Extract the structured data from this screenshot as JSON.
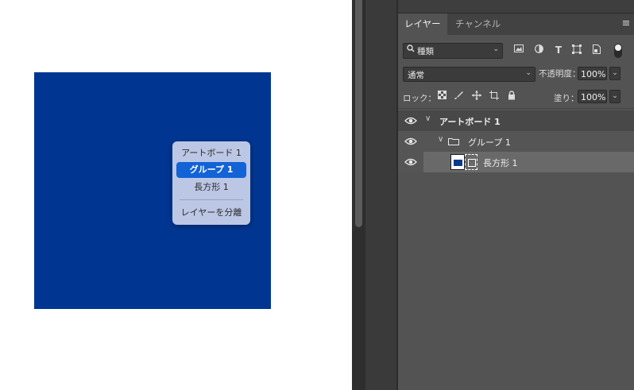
{
  "canvas": {
    "artboard_color": "#003692",
    "context_menu": {
      "items": [
        "アートボード 1",
        "グループ 1",
        "長方形 1"
      ],
      "selected_index": 1,
      "action": "レイヤーを分離"
    }
  },
  "layers_panel": {
    "tabs": [
      "レイヤー",
      "チャンネル"
    ],
    "active_tab": "レイヤー",
    "filter_label": "種類",
    "blend_mode": "通常",
    "opacity_label": "不透明度：",
    "opacity_value": "100%",
    "lock_label": "ロック：",
    "fill_label": "塗り：",
    "fill_value": "100%",
    "layers": [
      {
        "name": "アートボード 1",
        "type": "artboard",
        "visible": true
      },
      {
        "name": "グループ 1",
        "type": "group",
        "visible": true
      },
      {
        "name": "長方形 1",
        "type": "shape",
        "visible": true,
        "selected": true
      }
    ]
  },
  "colors": {
    "panel_bg": "#535353",
    "menu_highlight": "#1263d6",
    "artboard_blue": "#003692"
  }
}
